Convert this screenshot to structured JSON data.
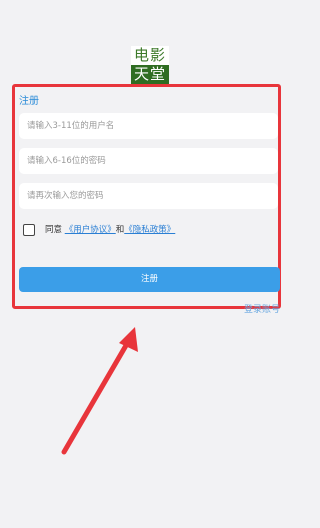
{
  "logo": {
    "line1": "电影",
    "line2": "天堂"
  },
  "form": {
    "title": "注册",
    "username_placeholder": "请输入3-11位的用户名",
    "password_placeholder": "请输入6-16位的密码",
    "confirm_placeholder": "请再次输入您的密码",
    "agree_prefix": "同意",
    "user_agreement": "《用户协议》",
    "agree_and": "和",
    "privacy_policy": "《隐私政策》",
    "submit_label": "注册",
    "switch_link": "登录账号"
  },
  "colors": {
    "highlight_frame": "#e8353b",
    "accent": "#3b9ee8"
  }
}
